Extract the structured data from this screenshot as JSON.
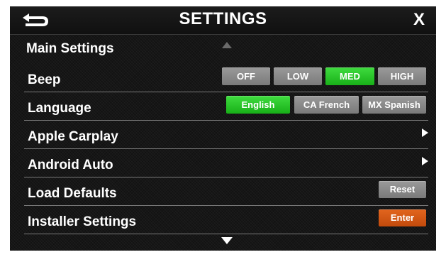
{
  "header": {
    "title": "SETTINGS",
    "close_label": "X",
    "back_icon": "back-arrow-icon"
  },
  "section": {
    "title": "Main Settings"
  },
  "rows": {
    "beep": {
      "label": "Beep",
      "options": [
        "OFF",
        "LOW",
        "MED",
        "HIGH"
      ],
      "selected": "MED"
    },
    "language": {
      "label": "Language",
      "options": [
        "English",
        "CA French",
        "MX Spanish"
      ],
      "selected": "English"
    },
    "apple_carplay": {
      "label": "Apple Carplay"
    },
    "android_auto": {
      "label": "Android Auto"
    },
    "load_defaults": {
      "label": "Load Defaults",
      "button": "Reset"
    },
    "installer_settings": {
      "label": "Installer Settings",
      "button": "Enter"
    }
  },
  "colors": {
    "selected": "#22c422",
    "unselected": "#8a8a8a",
    "enter": "#d5581a",
    "background": "#161616"
  }
}
